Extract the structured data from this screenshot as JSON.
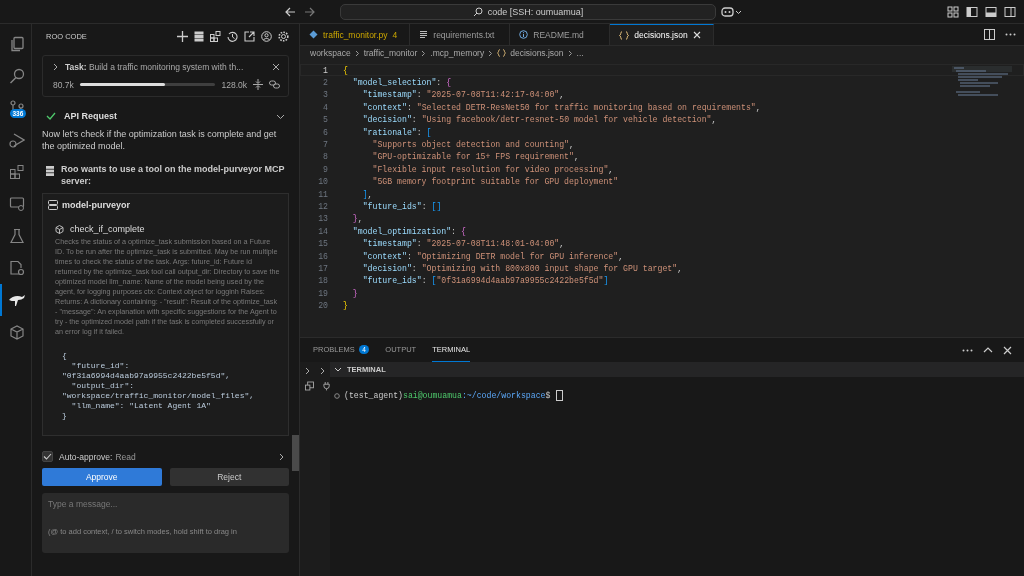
{
  "title_bar": {
    "search": "code [SSH: oumuamua]"
  },
  "activity_bar": [
    {
      "kind": "explorer",
      "selected": false
    },
    {
      "kind": "search",
      "selected": false
    },
    {
      "kind": "source-control",
      "selected": false,
      "badge": "336"
    },
    {
      "kind": "run",
      "selected": false
    },
    {
      "kind": "extensions",
      "selected": false
    },
    {
      "kind": "remote",
      "selected": false
    },
    {
      "kind": "testing",
      "selected": false
    },
    {
      "kind": "settings-file",
      "selected": false
    },
    {
      "kind": "roo",
      "selected": true
    },
    {
      "kind": "containers",
      "selected": false
    }
  ],
  "sidebar": {
    "title": "ROO CODE",
    "task": {
      "label": "**Task:** Build a traffic monitoring system with th...",
      "tokens_used": "80.7k",
      "level": 0.63,
      "context_window": "128.0k"
    },
    "api_request": {
      "title": "API Request",
      "done": true,
      "expanded": true
    },
    "message": "Now let's check if the optimization task is complete and get the optimized model.",
    "tool_request": {
      "heading": "Roo wants to use a tool on the model-purveyor MCP server:",
      "server": "model-purveyor",
      "tool": "check_if_complete",
      "description": "Checks the status of a optimize_task submission based on a Future ID. To be run after the optimize_task is submitted. May be run multiple times to check the status of the task. Args: future_id: Future id returned by the optimize_task tool call output_dir: Directory to save the optimized model llm_name: Name of the model being used by the agent, for logging purposes ctx: Context object for logginh Raises: Returns: A dictionary containing: - \"result\": Result of the optimize_task - \"message\": An explanation with specific suggestions for the Agent to try - the optimized model path if the task is completed successfully or an error log if it failed.",
      "arguments": [
        "{",
        "  \"future_id\":",
        "\"0f31a6994d4aab97a9955c2422be5f5d\",",
        "  \"output_dir\":",
        "\"workspace/traffic_monitor/model_files\",",
        "  \"llm_name\": \"Latent Agent 1A\"",
        "}"
      ]
    },
    "auto_approve": {
      "checked": true,
      "label": "Auto-approve:",
      "value": "Read"
    },
    "buttons": [
      {
        "label": "Approve",
        "kind": "primary"
      },
      {
        "label": "Reject",
        "kind": "secondary"
      }
    ],
    "input": {
      "placeholder": "Type a message...",
      "hint": "(@ to add context, / to switch modes, hold shift to drag in"
    }
  },
  "editor": {
    "tabs": [
      {
        "label": "traffic_monitor.py",
        "kind": "python",
        "badge": "4",
        "selected": false
      },
      {
        "label": "requirements.txt",
        "kind": "text",
        "selected": false
      },
      {
        "label": "README.md",
        "kind": "info",
        "selected": false
      },
      {
        "label": "decisions.json",
        "kind": "json",
        "selected": true
      }
    ],
    "breadcrumb": [
      {
        "label": "workspace",
        "kind": "folder"
      },
      {
        "label": "traffic_monitor",
        "kind": "folder"
      },
      {
        "label": ".mcp_memory",
        "kind": "folder"
      },
      {
        "label": "decisions.json",
        "kind": "json"
      },
      {
        "label": "...",
        "kind": "more"
      }
    ],
    "lines": [
      {
        "number": "1",
        "text": "{",
        "current": true
      },
      {
        "number": "2",
        "text": "  \"model_selection\": {",
        "current": false
      },
      {
        "number": "3",
        "text": "    \"timestamp\": \"2025-07-08T11:42:17-04:00\",",
        "current": false
      },
      {
        "number": "4",
        "text": "    \"context\": \"Selected DETR-ResNet50 for traffic monitoring based on requirements\",",
        "current": false
      },
      {
        "number": "5",
        "text": "    \"decision\": \"Using facebook/detr-resnet-50 model for vehicle detection\",",
        "current": false
      },
      {
        "number": "6",
        "text": "    \"rationale\": [",
        "current": false
      },
      {
        "number": "7",
        "text": "      \"Supports object detection and counting\",",
        "current": false
      },
      {
        "number": "8",
        "text": "      \"GPU-optimizable for 15+ FPS requirement\",",
        "current": false
      },
      {
        "number": "9",
        "text": "      \"Flexible input resolution for video processing\",",
        "current": false
      },
      {
        "number": "10",
        "text": "      \"5GB memory footprint suitable for GPU deployment\"",
        "current": false
      },
      {
        "number": "11",
        "text": "    ],",
        "current": false
      },
      {
        "number": "12",
        "text": "    \"future_ids\": []",
        "current": false
      },
      {
        "number": "13",
        "text": "  },",
        "current": false
      },
      {
        "number": "14",
        "text": "  \"model_optimization\": {",
        "current": false
      },
      {
        "number": "15",
        "text": "    \"timestamp\": \"2025-07-08T11:48:01-04:00\",",
        "current": false
      },
      {
        "number": "16",
        "text": "    \"context\": \"Optimizing DETR model for GPU inference\",",
        "current": false
      },
      {
        "number": "17",
        "text": "    \"decision\": \"Optimizing with 800x800 input shape for GPU target\",",
        "current": false
      },
      {
        "number": "18",
        "text": "    \"future_ids\": [\"0f31a6994d4aab97a9955c2422be5f5d\"]",
        "current": false
      },
      {
        "number": "19",
        "text": "  }",
        "current": false
      },
      {
        "number": "20",
        "text": "}",
        "current": false
      }
    ]
  },
  "panel": {
    "tabs": [
      {
        "label": "PROBLEMS",
        "badge": "4",
        "selected": false
      },
      {
        "label": "OUTPUT",
        "selected": false
      },
      {
        "label": "TERMINAL",
        "selected": true
      }
    ],
    "section": "TERMINAL",
    "terminal": {
      "env": "(test_agent)",
      "user": "sai@oumuamua",
      "path": ":~/code/workspace",
      "prompt": "$"
    }
  }
}
